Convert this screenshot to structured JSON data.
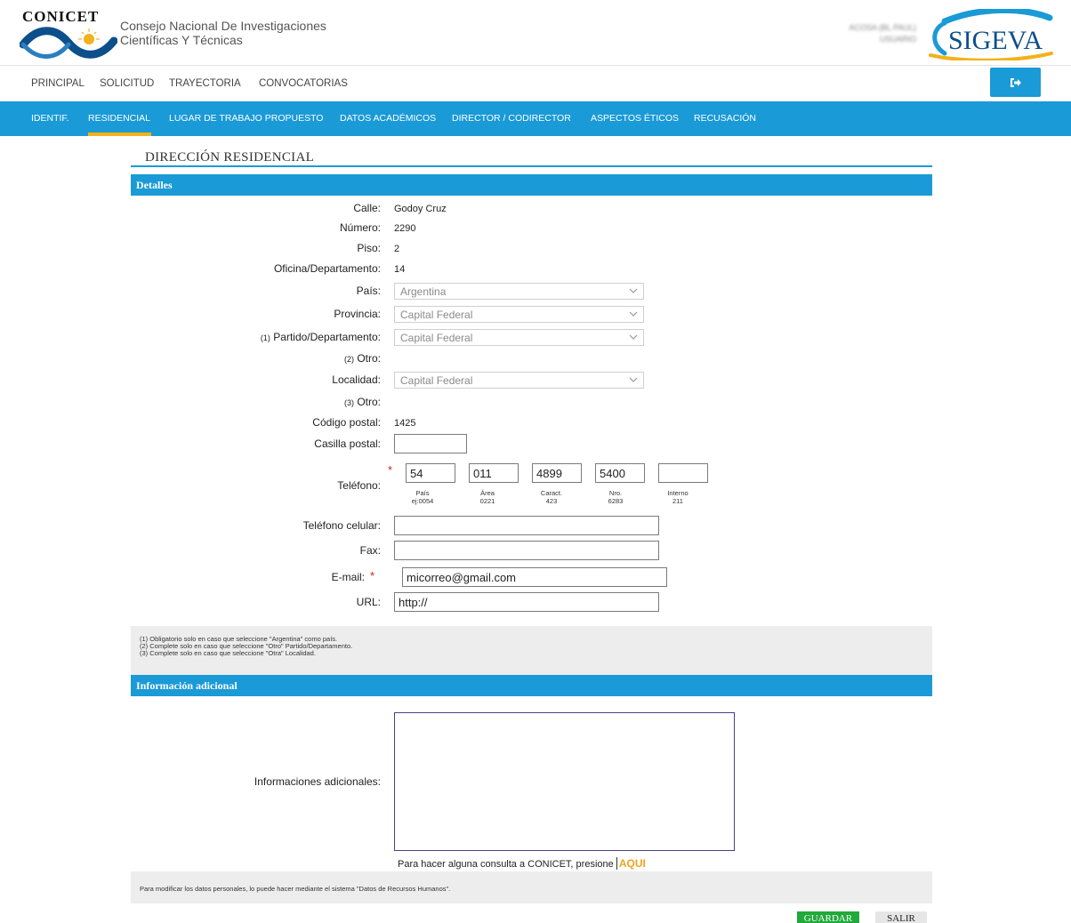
{
  "header": {
    "logo_word": "CONICET",
    "org_line1": "Consejo Nacional De Investigaciones",
    "org_line2": "Científicas Y Técnicas",
    "user_line1": "ACOSA (BL PAUL)",
    "user_line2": "USUARIO",
    "app_name": "SIGEVA",
    "colors": {
      "primary": "#1a9ad6",
      "accent": "#f2b21c",
      "brand_dark": "#0d4f8a"
    }
  },
  "mainnav": {
    "items": [
      "PRINCIPAL",
      "SOLICITUD",
      "TRAYECTORIA",
      "CONVOCATORIAS"
    ],
    "logout_icon": "sign-out-icon"
  },
  "subnav": {
    "items": [
      "IDENTIF.",
      "RESIDENCIAL",
      "LUGAR DE TRABAJO PROPUESTO",
      "DATOS ACADÉMICOS",
      "DIRECTOR / CODIRECTOR",
      "ASPECTOS ÉTICOS",
      "RECUSACIÓN"
    ],
    "active": "RESIDENCIAL"
  },
  "form": {
    "title": "DIRECCIÓN RESIDENCIAL",
    "details_header": "Detalles",
    "labels": {
      "calle": "Calle:",
      "numero": "Número:",
      "piso": "Piso:",
      "oficina": "Oficina/Departamento:",
      "pais": "País:",
      "provincia": "Provincia:",
      "partido_note": "(1)",
      "partido": "Partido/Departamento:",
      "otro1_note": "(2)",
      "otro1": "Otro:",
      "localidad": "Localidad:",
      "otro2_note": "(3)",
      "otro2": "Otro:",
      "cp": "Código postal:",
      "casilla": "Casilla postal:",
      "telefono": "Teléfono:",
      "celular": "Teléfono celular:",
      "fax": "Fax:",
      "email": "E-mail:",
      "url": "URL:"
    },
    "values": {
      "calle": "Godoy Cruz",
      "numero": "2290",
      "piso": "2",
      "oficina": "14",
      "pais": "Argentina",
      "provincia": "Capital Federal",
      "partido": "Capital Federal",
      "localidad": "Capital Federal",
      "cp": "1425",
      "casilla": "",
      "celular": "",
      "fax": "",
      "email": "micorreo@gmail.com",
      "url": "http://"
    },
    "required_mark": "*",
    "phone": {
      "pais": "54",
      "area": "011",
      "caract": "4899",
      "nro": "5400",
      "interno": "",
      "sub_pais_1": "País",
      "sub_pais_2": "ej:0054",
      "sub_area_1": "Área",
      "sub_area_2": "0221",
      "sub_caract_1": "Caract.",
      "sub_caract_2": "423",
      "sub_nro_1": "Nro.",
      "sub_nro_2": "6283",
      "sub_interno_1": "Interno",
      "sub_interno_2": "211"
    },
    "notes": [
      "(1)  Obligatorio solo en caso que seleccione \"Argentina\" como país.",
      "(2)  Complete solo en caso que seleccione \"Otro\" Partido/Departamento.",
      "(3)  Complete solo en caso que seleccione \"Otra\" Localidad."
    ],
    "additional_header": "Información adicional",
    "additional_label": "Informaciones adicionales:",
    "additional_value": "",
    "consult_text": "Para hacer alguna consulta a CONICET, presione",
    "consult_link": "AQUI",
    "footnote": "Para modificar los datos personales, lo puede hacer mediante el sistema \"Datos de Recursos Humanos\".",
    "save_label": "GUARDAR",
    "exit_label": "SALIR"
  }
}
